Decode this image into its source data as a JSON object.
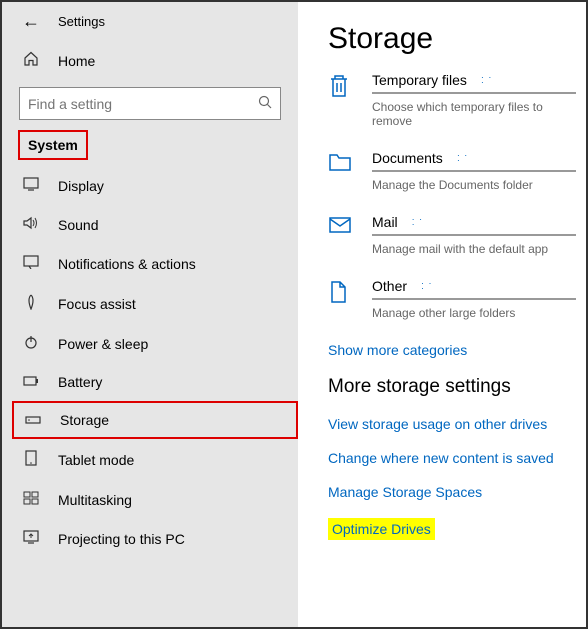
{
  "header": {
    "title": "Settings"
  },
  "home_label": "Home",
  "search": {
    "placeholder": "Find a setting"
  },
  "section_label": "System",
  "nav": [
    {
      "label": "Display"
    },
    {
      "label": "Sound"
    },
    {
      "label": "Notifications & actions"
    },
    {
      "label": "Focus assist"
    },
    {
      "label": "Power & sleep"
    },
    {
      "label": "Battery"
    },
    {
      "label": "Storage"
    },
    {
      "label": "Tablet mode"
    },
    {
      "label": "Multitasking"
    },
    {
      "label": "Projecting to this PC"
    }
  ],
  "page_title": "Storage",
  "categories": [
    {
      "label": "Temporary files",
      "desc": "Choose which temporary files to remove"
    },
    {
      "label": "Documents",
      "desc": "Manage the Documents folder"
    },
    {
      "label": "Mail",
      "desc": "Manage mail with the default app"
    },
    {
      "label": "Other",
      "desc": "Manage other large folders"
    }
  ],
  "show_more": "Show more categories",
  "more_title": "More storage settings",
  "links": [
    "View storage usage on other drives",
    "Change where new content is saved",
    "Manage Storage Spaces",
    "Optimize Drives"
  ]
}
